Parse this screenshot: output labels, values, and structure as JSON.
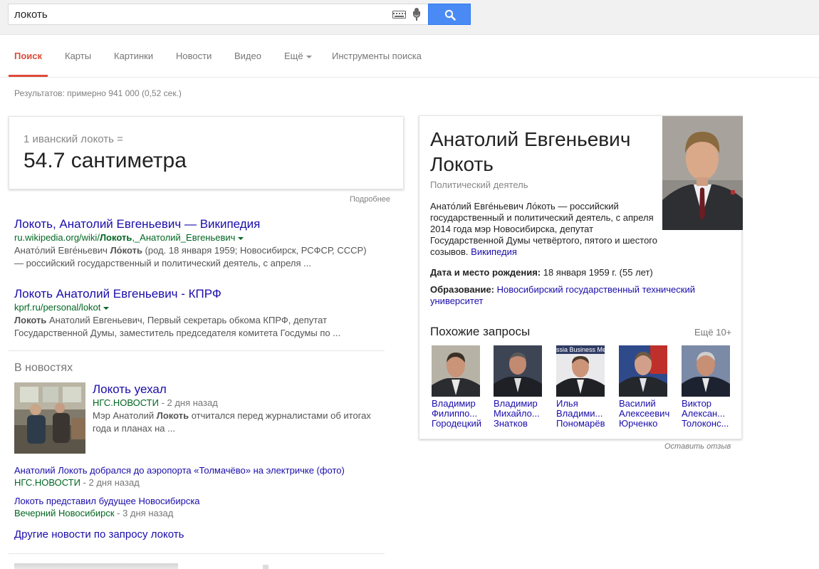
{
  "search": {
    "query": "локоть"
  },
  "tabs": [
    {
      "label": "Поиск"
    },
    {
      "label": "Карты"
    },
    {
      "label": "Картинки"
    },
    {
      "label": "Новости"
    },
    {
      "label": "Видео"
    },
    {
      "label": "Ещё"
    },
    {
      "label": "Инструменты поиска"
    }
  ],
  "result_stats": "Результатов: примерно 941 000 (0,52 сек.)",
  "answer": {
    "question": "1 иванский локоть =",
    "value": "54.7 сантиметра",
    "more": "Подробнее"
  },
  "results": [
    {
      "title": "Локоть, Анатолий Евгеньевич — Википедия",
      "url_pre": "ru.wikipedia.org/wiki/",
      "url_bold": "Локоть",
      "url_post": ",_Анатолий_Евгеньевич",
      "snip1_bold": "",
      "snip1_a": "Анато́лий Евге́ньевич ",
      "snip1_b": "Ло́коть",
      "snip1_c": " (род. 18 января 1959; Новосибирск, РСФСР, СССР)",
      "snip2": "— российский государственный и политический деятель, с апреля ..."
    },
    {
      "title": "Локоть Анатолий Евгеньевич - КПРФ",
      "url_pre": "kprf.ru/personal/lokot",
      "snip1_b": "Локоть",
      "snip1_c": " Анатолий Евгеньевич, Первый секретарь обкома КПРФ, депутат",
      "snip2": "Государственной Думы, заместитель председателя комитета Госдумы по ..."
    }
  ],
  "news": {
    "heading": "В новостях",
    "main": {
      "title": "Локоть уехал",
      "source": "НГС.НОВОСТИ",
      "time": " - 2 дня назад",
      "snip_a": "Мэр Анатолий ",
      "snip_b": "Локоть",
      "snip_c": " отчитался перед журналистами об итогах",
      "snip2": "года и планах на ..."
    },
    "items": [
      {
        "title": "Анатолий Локоть добрался до аэропорта «Толмачёво» на электричке (фото)",
        "source": "НГС.НОВОСТИ",
        "time": " - 2 дня назад"
      },
      {
        "title": "Локоть представил будущее Новосибирска",
        "source": "Вечерний Новосибирск",
        "time": " - 3 дня назад"
      }
    ],
    "more": "Другие новости по запросу локоть"
  },
  "knowledge": {
    "title1": "Анатолий Евгеньевич",
    "title2": "Локоть",
    "subtitle": "Политический деятель",
    "desc": "Анато́лий Евге́ньевич Ло́коть — российский государственный и политический деятель, с апреля 2014 года мэр Новосибирска, депутат Государственной Думы четвёртого, пятого и шестого созывов. ",
    "desc_link": "Википедия",
    "birth_label": "Дата и место рождения:",
    "birth_value": " 18 января 1959 г. (55 лет)",
    "edu_label": "Образование:",
    "edu_value": "Новосибирский государственный технический университет",
    "related_heading": "Похожие запросы",
    "related_more": "Ещё 10+",
    "related": [
      {
        "l1": "Владимир",
        "l2": "Филиппо...",
        "l3": "Городецкий"
      },
      {
        "l1": "Владимир",
        "l2": "Михайло...",
        "l3": "Знатков"
      },
      {
        "l1": "Илья",
        "l2": "Владими...",
        "l3": "Пономарёв",
        "banner": "ssia Business Mee"
      },
      {
        "l1": "Василий",
        "l2": "Алексеевич",
        "l3": "Юрченко"
      },
      {
        "l1": "Виктор",
        "l2": "Алексан...",
        "l3": "Толоконс..."
      }
    ],
    "feedback": "Оставить отзыв"
  }
}
